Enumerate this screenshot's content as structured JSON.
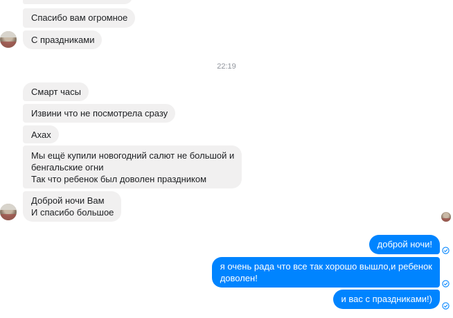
{
  "conversation": {
    "incoming_top": [
      {
        "text": "Спасибо вам огромное"
      },
      {
        "text": "С праздниками"
      }
    ],
    "timestamp": "22:19",
    "incoming_main": [
      {
        "lines": [
          "Смарт часы"
        ]
      },
      {
        "lines": [
          "Извини что не посмотрела сразу"
        ]
      },
      {
        "lines": [
          "Ахах"
        ]
      },
      {
        "lines": [
          "Мы ещё купили новогодний салют не большой и",
          "бенгальские огни",
          "Так что ребенок был доволен праздником"
        ]
      },
      {
        "lines": [
          "Доброй ночи Вам",
          "И спасибо большое"
        ]
      }
    ],
    "outgoing": [
      {
        "lines": [
          "доброй ночи!"
        ]
      },
      {
        "lines": [
          "я очень рада что все так хорошо вышло,и ребенок",
          "доволен!"
        ]
      },
      {
        "lines": [
          "и вас с праздниками!)"
        ]
      }
    ],
    "status_icon": "delivered-check-icon",
    "colors": {
      "incoming_bubble": "#f1f0f0",
      "outgoing_bubble": "#0084ff",
      "timestamp": "#90949c",
      "check": "#0084ff"
    }
  }
}
